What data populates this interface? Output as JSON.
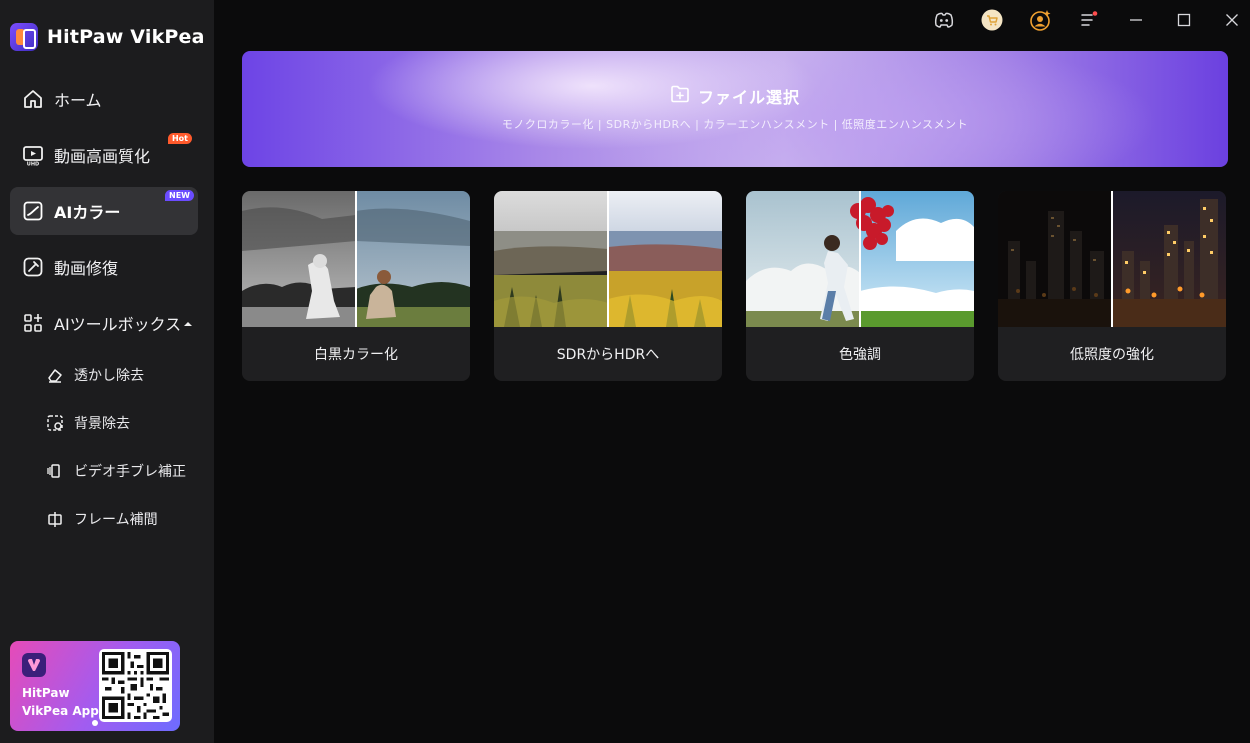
{
  "app": {
    "name": "HitPaw VikPea",
    "accent": "#6b4cff"
  },
  "sidebar": {
    "items": [
      {
        "label": "ホーム",
        "icon": "home-icon"
      },
      {
        "label": "動画高画質化",
        "icon": "uhd-video-icon",
        "badge": "Hot"
      },
      {
        "label": "AIカラー",
        "icon": "ai-color-icon",
        "badge": "NEW",
        "active": true
      },
      {
        "label": "動画修復",
        "icon": "repair-icon"
      },
      {
        "label": "AIツールボックス",
        "icon": "toolbox-icon"
      }
    ],
    "subitems": [
      {
        "label": "透かし除去",
        "icon": "eraser-icon"
      },
      {
        "label": "背景除去",
        "icon": "background-remove-icon"
      },
      {
        "label": "ビデオ手ブレ補正",
        "icon": "stabilize-icon"
      },
      {
        "label": "フレーム補間",
        "icon": "frame-interpolation-icon"
      }
    ],
    "promo": {
      "line1": "HitPaw",
      "line2": "VikPea App"
    }
  },
  "topbar": {
    "icons": [
      "discord-icon",
      "cart-icon",
      "account-icon",
      "menu-icon",
      "minimize-icon",
      "maximize-icon",
      "close-icon"
    ]
  },
  "banner": {
    "title": "ファイル選択",
    "subtitle": "モノクロカラー化 | SDRからHDRへ | カラーエンハンスメント | 低照度エンハンスメント"
  },
  "cards": [
    {
      "label": "白黒カラー化"
    },
    {
      "label": "SDRからHDRへ"
    },
    {
      "label": "色強調"
    },
    {
      "label": "低照度の強化"
    }
  ]
}
